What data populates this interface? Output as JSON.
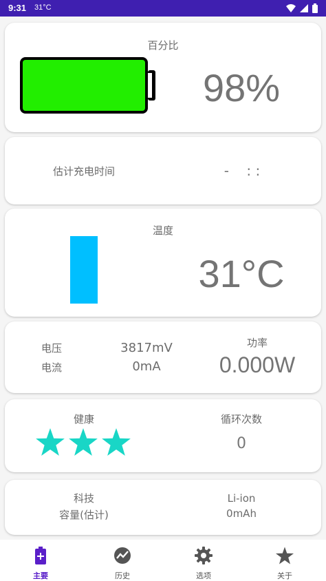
{
  "status_bar": {
    "time": "9:31",
    "temperature": "31°C"
  },
  "percentage_card": {
    "label": "百分比",
    "value": "98%",
    "level": 0.98
  },
  "charge_time_card": {
    "label": "估计充电时间",
    "value": "-    : :"
  },
  "temperature_card": {
    "label": "温度",
    "value": "31°C"
  },
  "electric_card": {
    "voltage_label": "电压",
    "voltage_value": "3817mV",
    "current_label": "电流",
    "current_value": "0mA",
    "power_label": "功率",
    "power_value": "0.000W"
  },
  "health_card": {
    "health_label": "健康",
    "stars": 3,
    "cycle_label": "循环次数",
    "cycle_value": "0"
  },
  "tech_card": {
    "tech_label": "科技",
    "tech_value": "Li-ion",
    "capacity_label": "容量(估计)",
    "capacity_value": "0mAh"
  },
  "nav": {
    "items": [
      {
        "label": "主要",
        "icon": "battery-plus-icon",
        "active": true
      },
      {
        "label": "历史",
        "icon": "history-chart-icon",
        "active": false
      },
      {
        "label": "选项",
        "icon": "gear-icon",
        "active": false
      },
      {
        "label": "关于",
        "icon": "star-icon",
        "active": false
      }
    ]
  },
  "colors": {
    "accent": "#3f1fb0",
    "battery_fill": "#22ee00",
    "temperature_bar": "#00bfff",
    "stars": "#19d6c6",
    "nav_active": "#5a1fc9"
  }
}
